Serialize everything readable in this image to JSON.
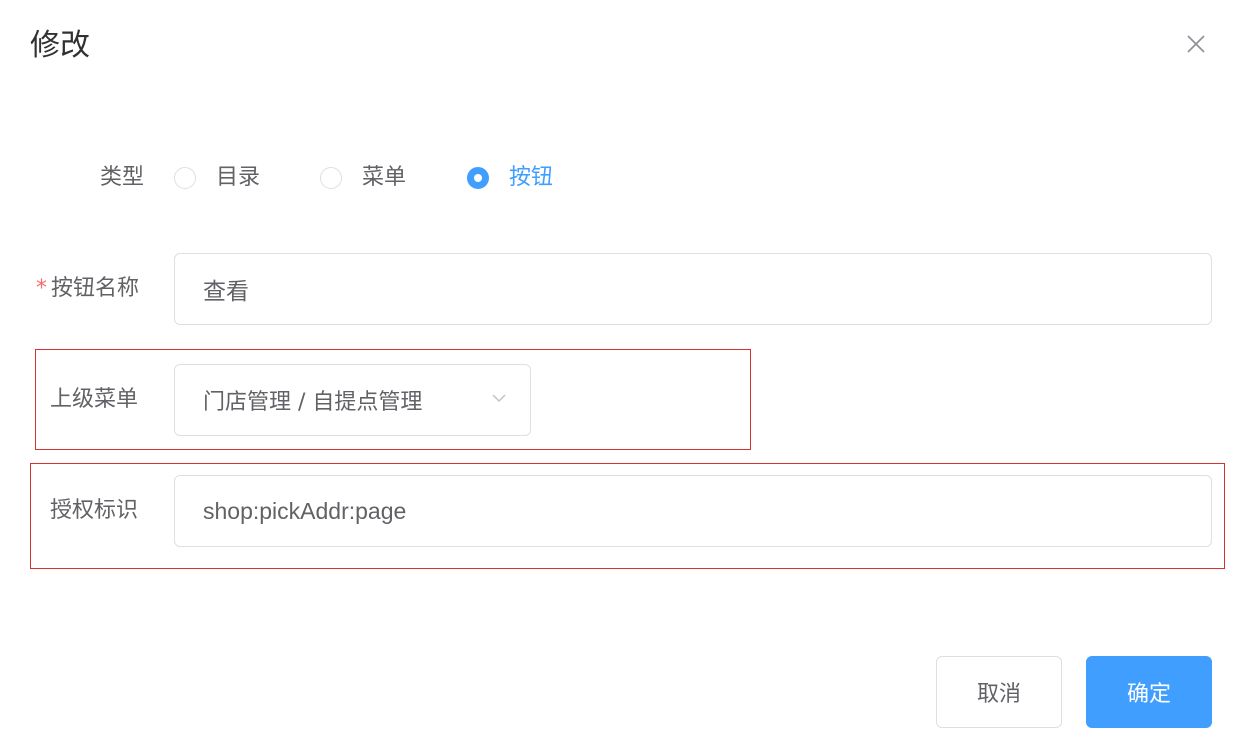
{
  "dialog": {
    "title": "修改",
    "close_icon": "close-icon"
  },
  "form": {
    "type": {
      "label": "类型",
      "options": [
        {
          "label": "目录",
          "checked": false
        },
        {
          "label": "菜单",
          "checked": false
        },
        {
          "label": "按钮",
          "checked": true
        }
      ]
    },
    "button_name": {
      "required_mark": "*",
      "label": "按钮名称",
      "value": "查看"
    },
    "parent_menu": {
      "label": "上级菜单",
      "value": "门店管理 / 自提点管理",
      "chevron_icon": "chevron-down-icon"
    },
    "permission": {
      "label": "授权标识",
      "value": "shop:pickAddr:page"
    }
  },
  "footer": {
    "cancel_label": "取消",
    "confirm_label": "确定"
  },
  "colors": {
    "primary": "#409eff",
    "highlight": "#d9312d",
    "required": "#f56c6c"
  }
}
